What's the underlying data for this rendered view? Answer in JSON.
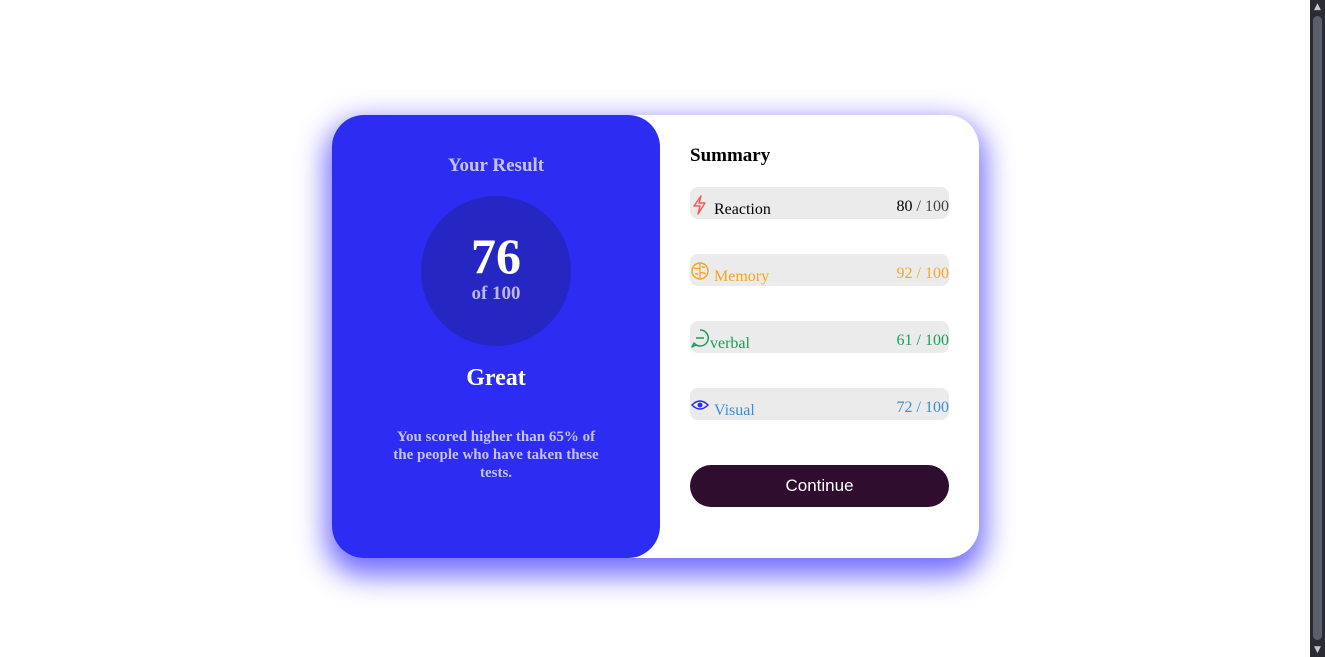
{
  "result": {
    "title": "Your Result",
    "score": "76",
    "score_of": "of 100",
    "rating": "Great",
    "description": "You scored higher than 65% of the people who have taken these tests."
  },
  "summary": {
    "title": "Summary",
    "items": [
      {
        "label": "Reaction",
        "score": "80",
        "max": "/ 100",
        "icon": "lightning-icon",
        "color": "#f55b5b"
      },
      {
        "label": "Memory",
        "score": "92",
        "max": "/ 100",
        "icon": "brain-icon",
        "color": "#f5a623"
      },
      {
        "label": "verbal",
        "score": "61",
        "max": "/ 100",
        "icon": "chat-bubble-icon",
        "color": "#1ba05a"
      },
      {
        "label": "Visual",
        "score": "72",
        "max": "/ 100",
        "icon": "eye-icon",
        "color": "#3c8ddb"
      }
    ]
  },
  "actions": {
    "continue_label": "Continue"
  },
  "colors": {
    "accent": "#2c2cf2",
    "circle": "#2626c2",
    "button": "#2e0d2e"
  }
}
